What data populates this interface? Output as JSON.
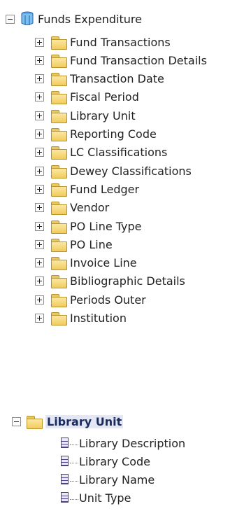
{
  "tree": {
    "root_label": "Funds Expenditure",
    "folders": [
      "Fund Transactions",
      "Fund Transaction Details",
      "Transaction Date",
      "Fiscal Period",
      "Library Unit",
      "Reporting Code",
      "LC Classifications",
      "Dewey Classifications",
      "Fund Ledger",
      "Vendor",
      "PO Line Type",
      "PO Line",
      "Invoice Line",
      "Bibliographic Details",
      "Periods Outer",
      "Institution"
    ]
  },
  "selected_folder": {
    "label": "Library Unit",
    "columns": [
      "Library Description",
      "Library Code",
      "Library Name",
      "Unit Type"
    ]
  }
}
